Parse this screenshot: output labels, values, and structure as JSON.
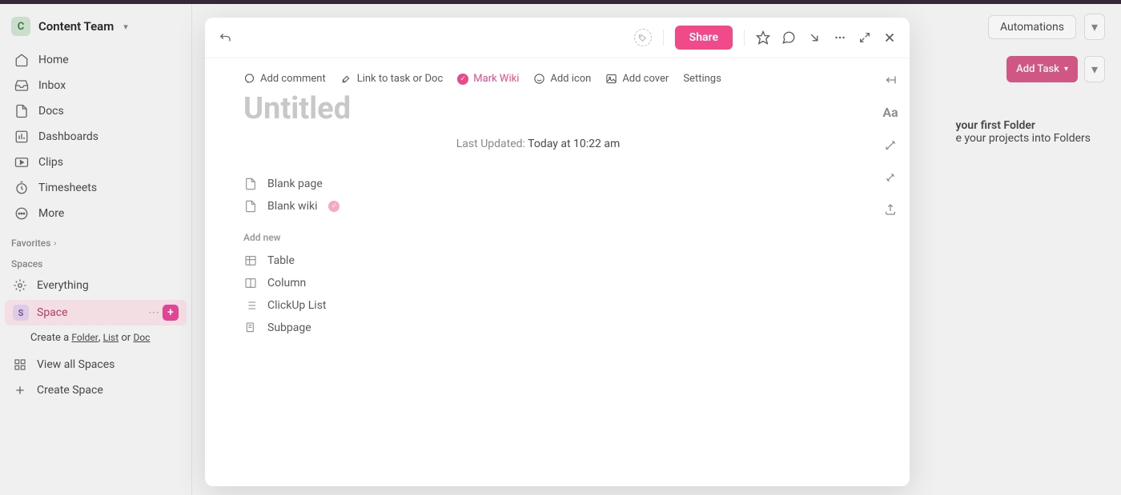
{
  "workspace": {
    "avatar_letter": "C",
    "name": "Content Team"
  },
  "sidebar": {
    "nav": [
      {
        "label": "Home",
        "icon": "home"
      },
      {
        "label": "Inbox",
        "icon": "inbox"
      },
      {
        "label": "Docs",
        "icon": "docs"
      },
      {
        "label": "Dashboards",
        "icon": "dashboards"
      },
      {
        "label": "Clips",
        "icon": "clips"
      },
      {
        "label": "Timesheets",
        "icon": "timesheets"
      },
      {
        "label": "More",
        "icon": "more"
      }
    ],
    "favorites_label": "Favorites",
    "spaces_label": "Spaces",
    "everything_label": "Everything",
    "space": {
      "avatar_letter": "S",
      "name": "Space"
    },
    "create_hint_prefix": "Create a ",
    "create_hint_folder": "Folder",
    "create_hint_list": "List",
    "create_hint_or": " or ",
    "create_hint_doc": "Doc",
    "view_all_label": "View all Spaces",
    "create_space_label": "Create Space"
  },
  "header": {
    "automations": "Automations",
    "add_task": "Add Task"
  },
  "hint_card": {
    "title": "your first Folder",
    "subtitle": "e your projects into Folders"
  },
  "modal": {
    "share_label": "Share",
    "actions": {
      "add_comment": "Add comment",
      "link_task": "Link to task or Doc",
      "mark_wiki": "Mark Wiki",
      "add_icon": "Add icon",
      "add_cover": "Add cover",
      "settings": "Settings"
    },
    "title_placeholder": "Untitled",
    "last_updated_label": "Last Updated:",
    "last_updated_value": "Today at 10:22 am",
    "templates": {
      "blank_page": "Blank page",
      "blank_wiki": "Blank wiki"
    },
    "add_new_label": "Add new",
    "add_new_items": {
      "table": "Table",
      "column": "Column",
      "clickup_list": "ClickUp List",
      "subpage": "Subpage"
    },
    "rail_text_icon": "Aa"
  }
}
